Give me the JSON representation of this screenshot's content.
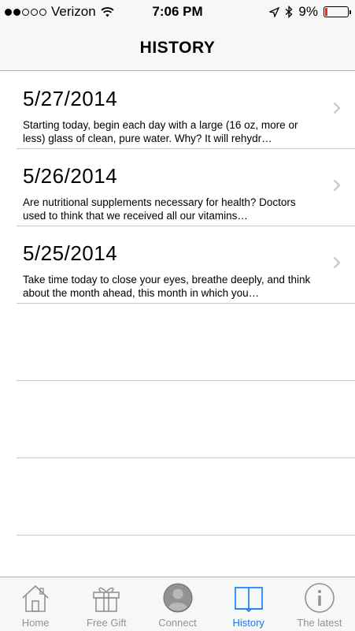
{
  "status_bar": {
    "signal_filled": 2,
    "signal_total": 5,
    "carrier": "Verizon",
    "time": "7:06 PM",
    "battery": "9%",
    "battery_level": 0.09,
    "icons": [
      "wifi-icon",
      "location-icon",
      "bluetooth-icon",
      "battery-icon"
    ]
  },
  "nav": {
    "title": "HISTORY"
  },
  "entries": [
    {
      "date": "5/27/2014",
      "preview": "Starting today, begin each day with a large (16 oz, more or less) glass of clean, pure water.  Why?  It will rehydr…"
    },
    {
      "date": "5/26/2014",
      "preview": "Are nutritional supplements necessary for health? Doctors used to think that we received all our vitamins…"
    },
    {
      "date": "5/25/2014",
      "preview": "Take time today to close your eyes, breathe deeply, and think about the month ahead, this month in which you…"
    }
  ],
  "tabs": [
    {
      "label": "Home",
      "icon": "house-icon"
    },
    {
      "label": "Free Gift",
      "icon": "gift-icon"
    },
    {
      "label": "Connect",
      "icon": "person-icon"
    },
    {
      "label": "History",
      "icon": "book-icon",
      "active": true
    },
    {
      "label": "The latest",
      "icon": "info-icon"
    }
  ],
  "colors": {
    "accent": "#0a7aff",
    "inactive": "#929292",
    "battery_low": "#e0312b"
  }
}
